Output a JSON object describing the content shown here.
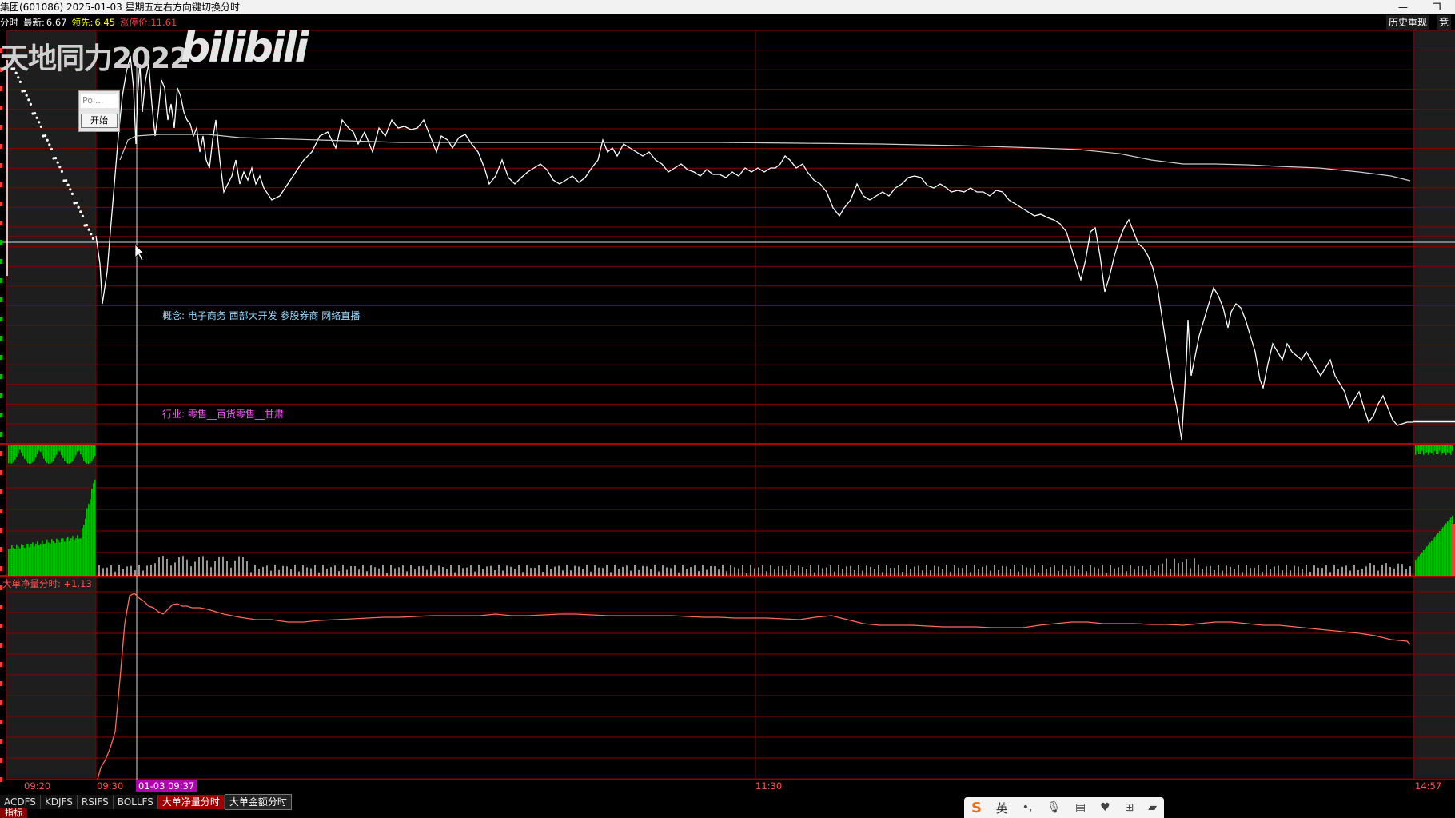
{
  "window": {
    "title": "集团(601086) 2025-01-03 星期五",
    "hint": "左右方向键切换分时",
    "minimize_icon": "—",
    "restore_icon": "❐"
  },
  "infobar": {
    "mode": "分时",
    "latest_label": "最新:",
    "latest": "6.67",
    "leader_label": "领先:",
    "leader": "6.45",
    "limit_label": "涨停价:",
    "limit": "11.61"
  },
  "top_right": {
    "history": "历史重现",
    "bid": "竞"
  },
  "watermark": {
    "text": "天地同力2022",
    "logo": "bilibili"
  },
  "popup": {
    "input_placeholder": "Poi...",
    "start_button": "开始"
  },
  "concept_line": "概念: 电子商务  西部大开发  参股券商  网络直播",
  "industry_line": "行业: 零售__百货零售__甘肃",
  "indicator_label": "大单净量分时: +1.13",
  "time_axis": {
    "t1": "09:20",
    "t2": "09:30",
    "t3": "01-03 09:37",
    "t4": "11:30",
    "t5": "14:57"
  },
  "tabs": [
    "ACDFS",
    "KDJFS",
    "RSIFS",
    "BOLLFS",
    "大单净量分时",
    "大单金额分时"
  ],
  "active_tab": "大单净量分时",
  "indicator_button": "指标",
  "ime": {
    "logo": "S",
    "lang": "英",
    "icons": [
      "punctuation-icon",
      "microphone-icon",
      "keyboard-icon",
      "skin-icon",
      "grid-icon",
      "toolbox-icon"
    ]
  },
  "colors": {
    "grid": "#8b0000",
    "price_line": "#ffffff",
    "avg_line": "#cccccc",
    "volume_green": "#00c000",
    "indicator_line": "#ff6a5a"
  }
}
